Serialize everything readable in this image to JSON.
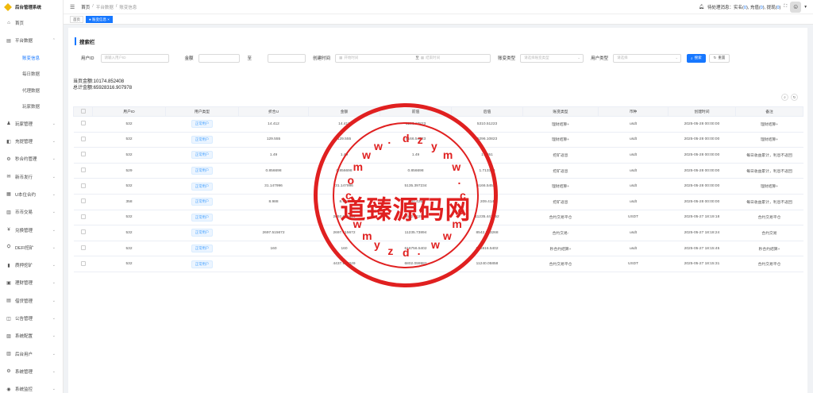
{
  "app": {
    "title": "后台管理系统"
  },
  "sidebar": {
    "items": [
      {
        "icon": "home-icon",
        "glyph": "⌂",
        "label": "首页",
        "chevron": false
      },
      {
        "icon": "data-icon",
        "glyph": "▤",
        "label": "平台数据",
        "chevron": true,
        "open": true,
        "children": [
          {
            "label": "账变信息",
            "active": true
          },
          {
            "label": "每日数据",
            "active": false
          },
          {
            "label": "代理数据",
            "active": false
          },
          {
            "label": "玩家数据",
            "active": false
          }
        ]
      },
      {
        "icon": "user-icon",
        "glyph": "♟",
        "label": "玩家管理",
        "chevron": true
      },
      {
        "icon": "deposit-icon",
        "glyph": "◧",
        "label": "充提管理",
        "chevron": true
      },
      {
        "icon": "contract-icon",
        "glyph": "⚙",
        "label": "秒合约管理",
        "chevron": true
      },
      {
        "icon": "coin-icon",
        "glyph": "✉",
        "label": "新币发行",
        "chevron": true
      },
      {
        "icon": "grid-icon",
        "glyph": "▦",
        "label": "U本位合约",
        "chevron": true
      },
      {
        "icon": "market-icon",
        "glyph": "▥",
        "label": "币币交易",
        "chevron": true
      },
      {
        "icon": "yen-icon",
        "glyph": "¥",
        "label": "兑换管理",
        "chevron": true
      },
      {
        "icon": "defi-icon",
        "glyph": "⛭",
        "label": "DEFI挖矿",
        "chevron": true
      },
      {
        "icon": "chart-icon",
        "glyph": "▮",
        "label": "质押挖矿",
        "chevron": true
      },
      {
        "icon": "finance-icon",
        "glyph": "▣",
        "label": "理财管理",
        "chevron": true
      },
      {
        "icon": "loan-icon",
        "glyph": "▤",
        "label": "借贷管理",
        "chevron": true
      },
      {
        "icon": "notice-icon",
        "glyph": "◫",
        "label": "公告管理",
        "chevron": true
      },
      {
        "icon": "config-icon",
        "glyph": "▨",
        "label": "系统配置",
        "chevron": true
      },
      {
        "icon": "admin-icon",
        "glyph": "▥",
        "label": "后台用户",
        "chevron": true
      },
      {
        "icon": "settings-icon",
        "glyph": "⚙",
        "label": "系统管理",
        "chevron": true
      },
      {
        "icon": "monitor-icon",
        "glyph": "◉",
        "label": "系统监控",
        "chevron": true
      }
    ]
  },
  "header": {
    "breadcrumb": [
      "首页",
      "/",
      "平台数据",
      "/",
      "账变信息"
    ],
    "notice": "待处理消息：实名(",
    "realname_count": "0",
    "recharge_label": "), 充值(",
    "recharge_count": "0",
    "withdraw_label": "), 提现(",
    "withdraw_count": "0",
    "tail": ")"
  },
  "tags": [
    {
      "label": "首页",
      "active": false
    },
    {
      "label": "● 账变信息 ×",
      "active": true
    }
  ],
  "search": {
    "title": "搜索栏",
    "user_id_label": "用户ID",
    "user_id_placeholder": "请输入用户ID",
    "amount_label": "金额",
    "to_label": "至",
    "create_time_label": "创建时间",
    "start_placeholder": "开始时间",
    "end_placeholder": "结束时间",
    "account_type_label": "账变类型",
    "account_type_placeholder": "请选择账变类型",
    "user_type_label": "用户类型",
    "user_type_placeholder": "请选择",
    "search_button": "搜索",
    "reset_button": "重置"
  },
  "totals": {
    "page_amount": "当页金额:10174.852408",
    "total_amount": "总计金额:65928316.907978"
  },
  "table": {
    "columns": [
      "用户ID",
      "用户类型",
      "折合U",
      "金额",
      "前值",
      "后值",
      "账变类型",
      "币种",
      "创建时间",
      "备注"
    ],
    "rows": [
      [
        "532",
        "正常用户",
        "14.412",
        "14.412",
        "5296.10823",
        "5310.51223",
        "理财结算+",
        "usdt",
        "2025-05-28 00:00:00",
        "理财结算+"
      ],
      [
        "532",
        "正常用户",
        "129.555",
        "129.555",
        "5166.54523",
        "5296.10823",
        "理财结算+",
        "usdt",
        "2025-05-28 00:00:00",
        "理财结算+"
      ],
      [
        "532",
        "正常用户",
        "1.49",
        "1.49",
        "1.49",
        "1.4951",
        "挖矿返息",
        "usdt",
        "2025-05-28 00:00:00",
        "每日收益累计，利息不返回"
      ],
      [
        "529",
        "正常用户",
        "0.856698",
        "0.856698",
        "0.856698",
        "1.713396",
        "挖矿返息",
        "usdt",
        "2025-05-28 00:00:00",
        "每日收益累计，利息不返回"
      ],
      [
        "532",
        "正常用户",
        "31.147996",
        "31.147996",
        "5135.397234",
        "5166.54523",
        "理财结算+",
        "usdt",
        "2025-05-28 00:00:00",
        "理财结算+"
      ],
      [
        "358",
        "正常用户",
        "8.988",
        "8.988",
        "200.426",
        "209.414",
        "挖矿返息",
        "usdt",
        "2025-05-28 00:00:00",
        "每日收益累计，利息不返回"
      ],
      [
        "532",
        "正常用户",
        "",
        "2692.666444",
        "8542.962908",
        "11235.441352",
        "合约交易平仓",
        "USDT",
        "2025-05-27 18:19:18",
        "合约交易平仓"
      ],
      [
        "532",
        "正常用户",
        "2697.515672",
        "2697.515672",
        "11235.73894",
        "8542.223268",
        "合约交易-",
        "usdt",
        "2025-05-27 18:18:24",
        "合约交易"
      ],
      [
        "532",
        "正常用户",
        "160",
        "160",
        "616756.5402",
        "616916.5402",
        "秒合约结算+",
        "usdt",
        "2025-05-27 18:15:45",
        "秒合约结算+"
      ],
      [
        "532",
        "正常用户",
        "",
        "4437.956049",
        "6802.099982",
        "11240.05858",
        "合约交易平仓",
        "USDT",
        "2025-05-27 18:15:31",
        "合约交易平仓"
      ]
    ]
  },
  "stamp": {
    "main_text": "道臻源码网",
    "ring_chars": [
      "d",
      "z",
      "y",
      "m",
      "w",
      ".",
      "c",
      "o",
      "m",
      "w",
      "w",
      ".",
      "d",
      "z",
      "y",
      "m",
      "w",
      ".",
      "c",
      "o",
      "m",
      "w",
      "w",
      "."
    ]
  },
  "colors": {
    "accent": "#1677ff",
    "stamp": "#e02020"
  }
}
